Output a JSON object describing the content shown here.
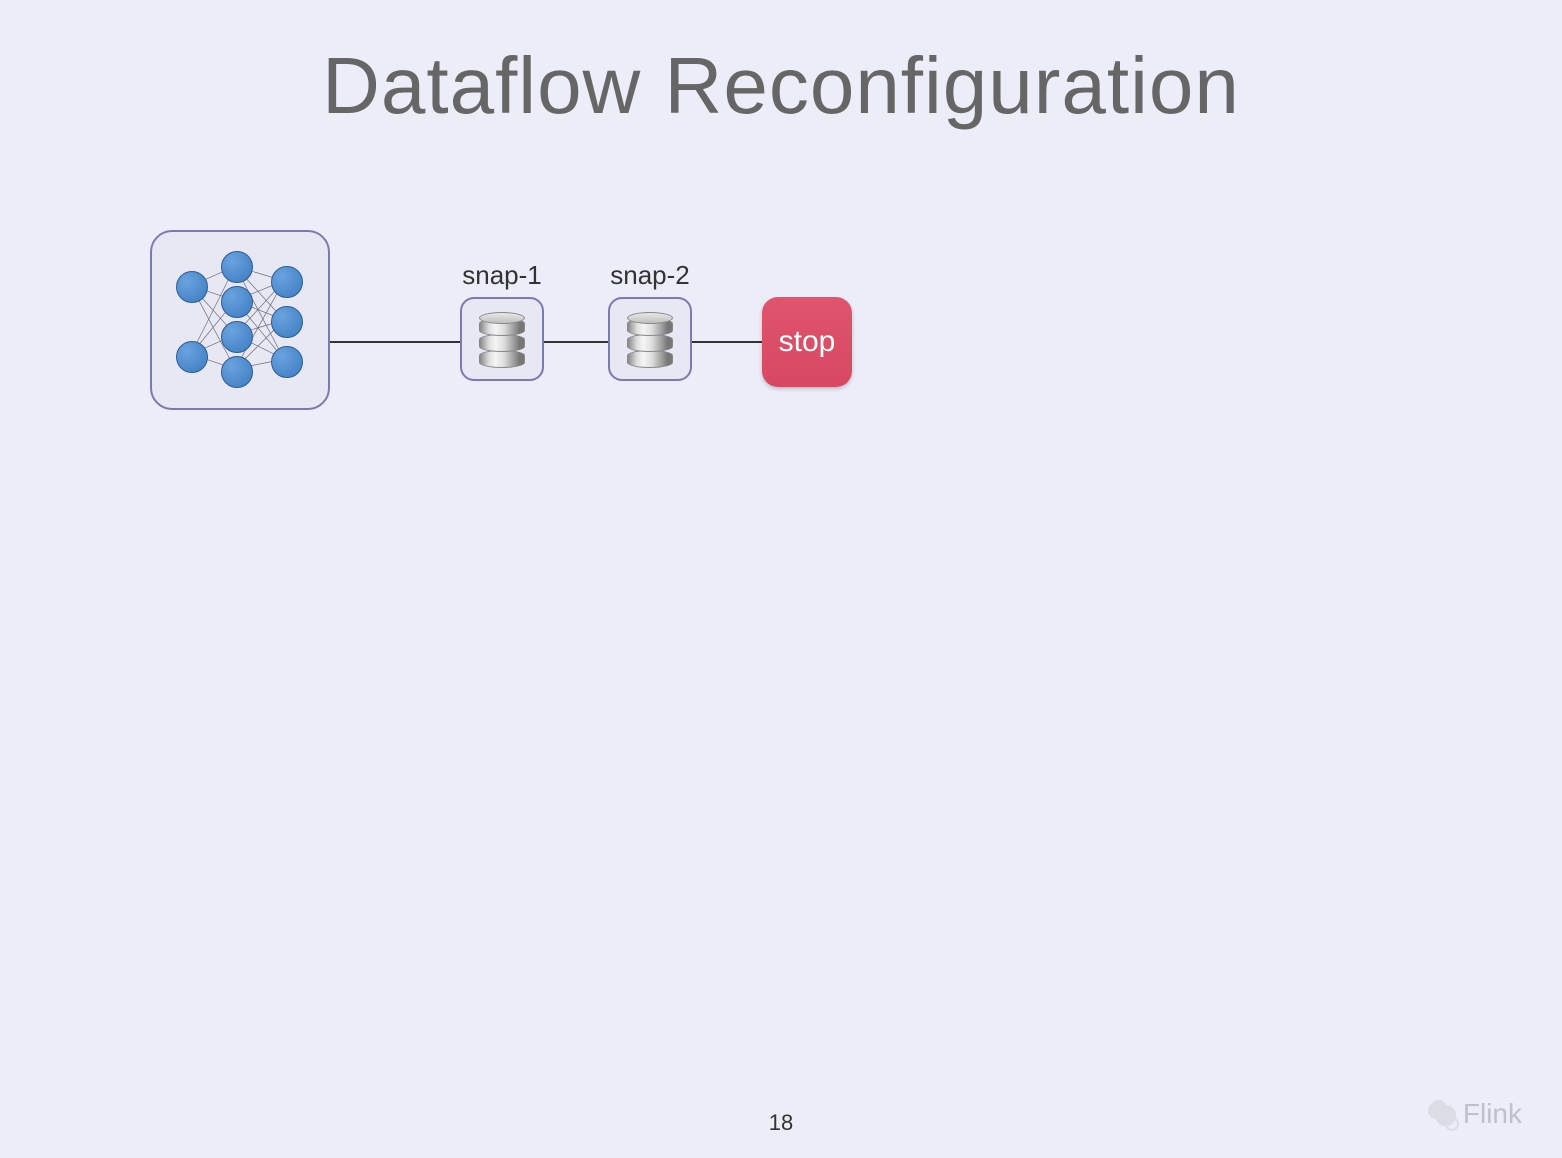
{
  "title": "Dataflow Reconfiguration",
  "snapshots": [
    {
      "label": "snap-1"
    },
    {
      "label": "snap-2"
    }
  ],
  "stop_label": "stop",
  "page_number": "18",
  "watermark": "Flink"
}
